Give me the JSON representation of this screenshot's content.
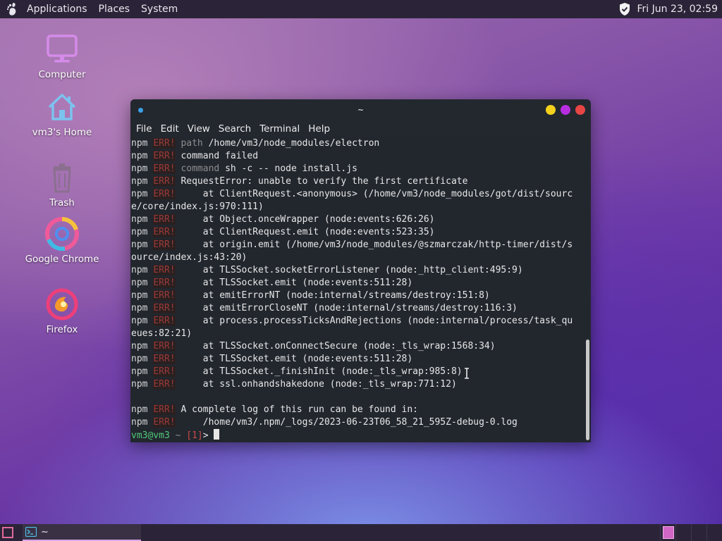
{
  "top_panel": {
    "menu": [
      "Applications",
      "Places",
      "System"
    ],
    "clock": "Fri Jun 23, 02:59"
  },
  "desktop_icons": [
    {
      "label": "Computer",
      "icon": "computer-icon"
    },
    {
      "label": "vm3's Home",
      "icon": "home-folder-icon"
    },
    {
      "label": "Trash",
      "icon": "trash-icon"
    },
    {
      "label": "Google Chrome",
      "icon": "chrome-icon"
    },
    {
      "label": "Firefox",
      "icon": "firefox-icon"
    }
  ],
  "terminal": {
    "title": "~",
    "menu": [
      "File",
      "Edit",
      "View",
      "Search",
      "Terminal",
      "Help"
    ],
    "lines": [
      {
        "npm": "npm",
        "tag": "ERR!",
        "text": " path /home/vm3/node_modules/electron",
        "dimPrefix": "path"
      },
      {
        "npm": "npm",
        "tag": "ERR!",
        "text": " command failed"
      },
      {
        "npm": "npm",
        "tag": "ERR!",
        "text": " command sh -c -- node install.js",
        "dimPrefix": "command"
      },
      {
        "npm": "npm",
        "tag": "ERR!",
        "text": " RequestError: unable to verify the first certificate"
      },
      {
        "npm": "npm",
        "tag": "ERR!",
        "text": "     at ClientRequest.<anonymous> (/home/vm3/node_modules/got/dist/sourc"
      },
      {
        "npm": "",
        "tag": "",
        "text": "e/core/index.js:970:111)"
      },
      {
        "npm": "npm",
        "tag": "ERR!",
        "text": "     at Object.onceWrapper (node:events:626:26)"
      },
      {
        "npm": "npm",
        "tag": "ERR!",
        "text": "     at ClientRequest.emit (node:events:523:35)"
      },
      {
        "npm": "npm",
        "tag": "ERR!",
        "text": "     at origin.emit (/home/vm3/node_modules/@szmarczak/http-timer/dist/s"
      },
      {
        "npm": "",
        "tag": "",
        "text": "ource/index.js:43:20)"
      },
      {
        "npm": "npm",
        "tag": "ERR!",
        "text": "     at TLSSocket.socketErrorListener (node:_http_client:495:9)"
      },
      {
        "npm": "npm",
        "tag": "ERR!",
        "text": "     at TLSSocket.emit (node:events:511:28)"
      },
      {
        "npm": "npm",
        "tag": "ERR!",
        "text": "     at emitErrorNT (node:internal/streams/destroy:151:8)"
      },
      {
        "npm": "npm",
        "tag": "ERR!",
        "text": "     at emitErrorCloseNT (node:internal/streams/destroy:116:3)"
      },
      {
        "npm": "npm",
        "tag": "ERR!",
        "text": "     at process.processTicksAndRejections (node:internal/process/task_qu"
      },
      {
        "npm": "",
        "tag": "",
        "text": "eues:82:21)"
      },
      {
        "npm": "npm",
        "tag": "ERR!",
        "text": "     at TLSSocket.onConnectSecure (node:_tls_wrap:1568:34)"
      },
      {
        "npm": "npm",
        "tag": "ERR!",
        "text": "     at TLSSocket.emit (node:events:511:28)"
      },
      {
        "npm": "npm",
        "tag": "ERR!",
        "text": "     at TLSSocket._finishInit (node:_tls_wrap:985:8)"
      },
      {
        "npm": "npm",
        "tag": "ERR!",
        "text": "     at ssl.onhandshakedone (node:_tls_wrap:771:12)"
      },
      {
        "npm": "",
        "tag": "",
        "text": ""
      },
      {
        "npm": "npm",
        "tag": "ERR!",
        "text": " A complete log of this run can be found in:"
      },
      {
        "npm": "npm",
        "tag": "ERR!",
        "text": "     /home/vm3/.npm/_logs/2023-06-23T06_58_21_595Z-debug-0.log"
      }
    ],
    "prompt": {
      "user": "vm3@vm3",
      "cwd": "~",
      "status": "[1]",
      "symbol": ">"
    }
  },
  "bottom_panel": {
    "task_label": "~"
  },
  "colors": {
    "panel": "#2b2438",
    "terminal_bg": "#22272e",
    "err_red": "#9a3a3a",
    "prompt_green": "#50c878",
    "btn_yellow": "#f4d21c",
    "btn_purple": "#b62ee0",
    "btn_red": "#e84545"
  }
}
